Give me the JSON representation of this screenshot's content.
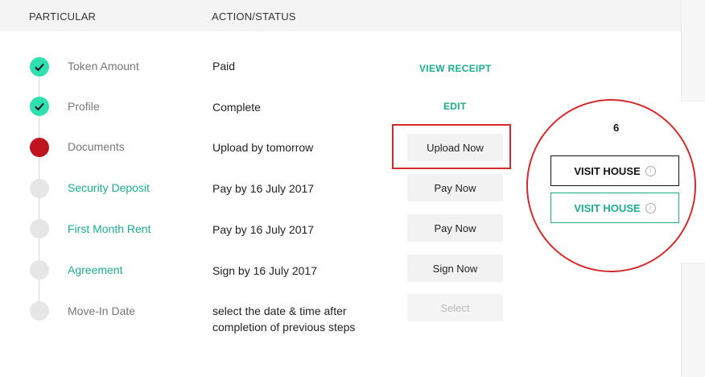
{
  "header": {
    "particular": "PARTICULAR",
    "action_status": "ACTION/STATUS"
  },
  "steps": [
    {
      "label": "Token Amount",
      "status": "Paid",
      "action": "VIEW RECEIPT",
      "state": "done"
    },
    {
      "label": "Profile",
      "status": "Complete",
      "action": "EDIT",
      "state": "done"
    },
    {
      "label": "Documents",
      "status": "Upload by tomorrow",
      "action": "Upload Now",
      "state": "current"
    },
    {
      "label": "Security Deposit",
      "status": "Pay by 16 July 2017",
      "action": "Pay Now",
      "state": "pending"
    },
    {
      "label": "First Month Rent",
      "status": "Pay by 16 July 2017",
      "action": "Pay Now",
      "state": "pending"
    },
    {
      "label": "Agreement",
      "status": "Sign by 16 July 2017",
      "action": "Sign Now",
      "state": "pending"
    },
    {
      "label": "Move-In Date",
      "status_line1": "select the date & time after",
      "status_line2": "completion of previous steps",
      "action": "Select",
      "state": "pending"
    }
  ],
  "annotation": {
    "count": "6",
    "visit_house_dark": "VISIT HOUSE",
    "visit_house_teal": "VISIT HOUSE",
    "info_glyph": "i"
  },
  "colors": {
    "done": "#2ee0b0",
    "current": "#c1121f",
    "pending": "#e6e6e6",
    "accent": "#1aae8f",
    "highlight": "#d42a2a"
  }
}
